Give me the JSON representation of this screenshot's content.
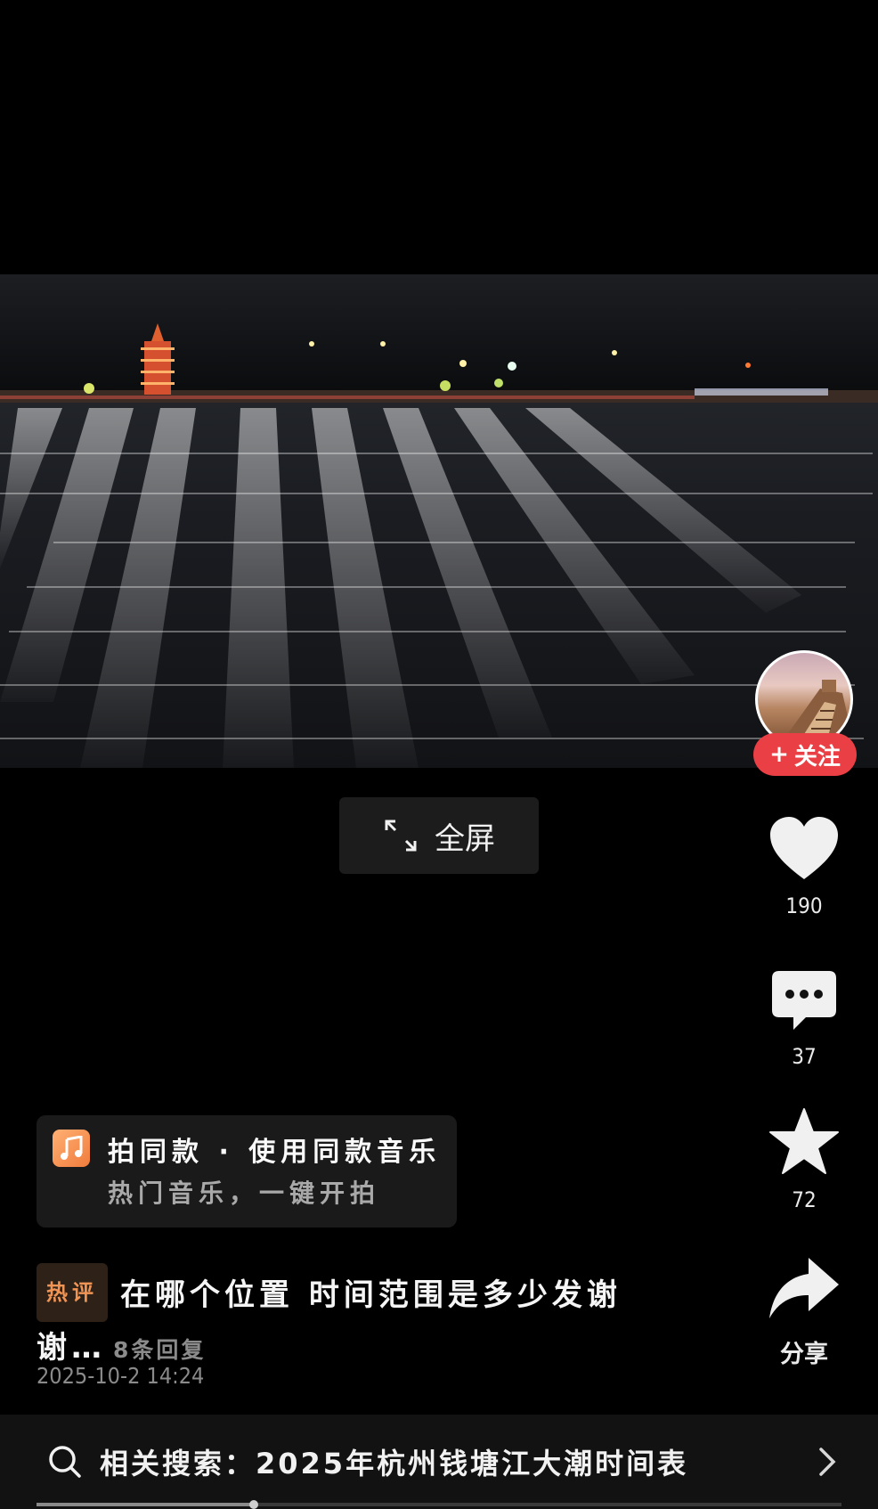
{
  "video": {
    "description_icon": "night-river-tide-video"
  },
  "fullscreen": {
    "label": "全屏"
  },
  "author": {
    "follow_label": "关注"
  },
  "actions": {
    "like_count": "190",
    "comment_count": "37",
    "favorite_count": "72",
    "share_label": "分享"
  },
  "music": {
    "title": "拍同款 · 使用同款音乐",
    "subtitle": "热门音乐，一键开拍"
  },
  "hot_comment": {
    "tag": "热评",
    "text": "在哪个位置 时间范围是多少发谢谢…",
    "replies": "8条回复",
    "time": "2025-10-2 14:24"
  },
  "related_search": {
    "label": "相关搜索：2025年杭州钱塘江大潮时间表"
  },
  "playback": {
    "progress": 0.27
  },
  "colors": {
    "follow": "#ea3f44",
    "hot_tag": "#f09455",
    "music_icon": "#f07c3c"
  }
}
